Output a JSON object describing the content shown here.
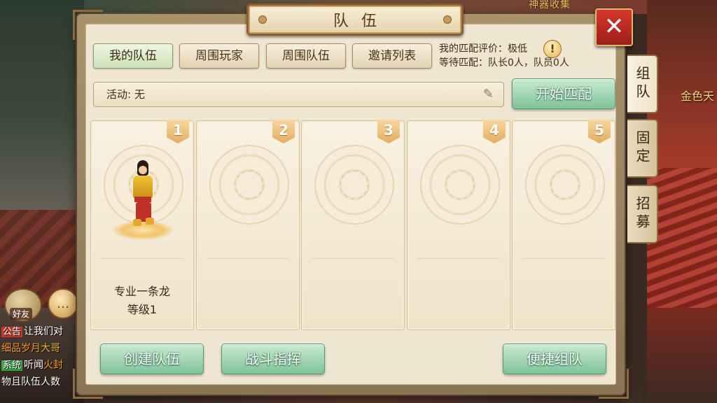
{
  "background": {
    "top_banner": "神器收集",
    "right_label": "金色天",
    "friend_label": "好友",
    "chat_icon": "speech-bubble-icon",
    "chat_lines": [
      {
        "tag": "公告",
        "text": "让我们对"
      },
      {
        "tag": "",
        "text_orange": "细品岁月",
        "text_amber": "大哥"
      },
      {
        "tag": "系统",
        "text": "听闻",
        "text_extra": "火封"
      },
      {
        "tag": "",
        "text": "物且队伍人数"
      }
    ]
  },
  "dialog": {
    "title": "队伍",
    "close_icon": "close-x-icon",
    "tabs": [
      {
        "label": "我的队伍",
        "active": true
      },
      {
        "label": "周围玩家",
        "active": false
      },
      {
        "label": "周围队伍",
        "active": false
      },
      {
        "label": "邀请列表",
        "active": false
      }
    ],
    "match_rating": "我的匹配评价：极低",
    "match_waiting": "等待匹配：队长0人，队员0人",
    "info_icon_glyph": "!",
    "activity_label": "活动: 无",
    "start_match": "开始匹配",
    "slots": [
      {
        "number": "1",
        "name": "专业一条龙",
        "level": "等级1"
      },
      {
        "number": "2"
      },
      {
        "number": "3"
      },
      {
        "number": "4"
      },
      {
        "number": "5"
      }
    ],
    "buttons": {
      "create_team": "创建队伍",
      "battle_command": "战斗指挥",
      "quick_team": "便捷组队"
    },
    "side_tabs": [
      {
        "label": "组队",
        "active": true
      },
      {
        "label": "固定",
        "active": false
      },
      {
        "label": "招募",
        "active": false
      }
    ]
  },
  "colors": {
    "accent_green": "#7fc29a",
    "close_red": "#d8372c",
    "slot_number": "#e4ad5e"
  }
}
